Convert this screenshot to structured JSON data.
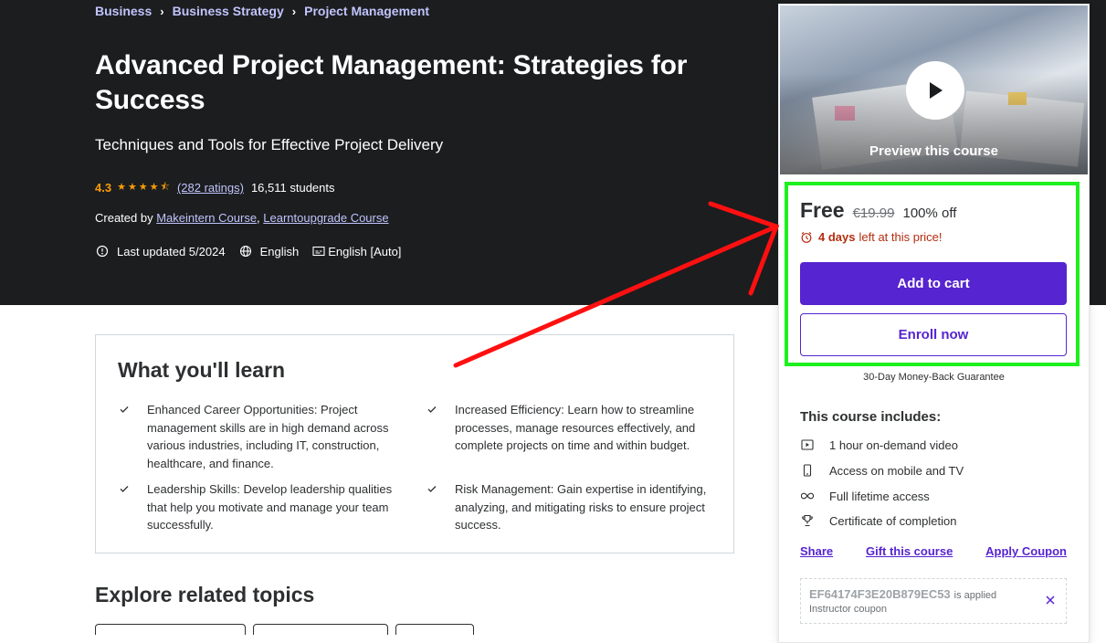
{
  "breadcrumb": [
    "Business",
    "Business Strategy",
    "Project Management"
  ],
  "course": {
    "title": "Advanced Project Management: Strategies for Success",
    "subtitle": "Techniques and Tools for Effective Project Delivery",
    "rating": "4.3",
    "ratings_count": "(282 ratings)",
    "students": "16,511 students",
    "created_by_label": "Created by",
    "instructors": [
      "Makeintern Course",
      "Learntoupgrade Course"
    ],
    "last_updated": "Last updated 5/2024",
    "language": "English",
    "captions": "English [Auto]"
  },
  "learn": {
    "title": "What you'll learn",
    "items": [
      "Enhanced Career Opportunities: Project management skills are in high demand across various industries, including IT, construction, healthcare, and finance.",
      "Increased Efficiency: Learn how to streamline processes, manage resources effectively, and complete projects on time and within budget.",
      "Leadership Skills: Develop leadership qualities that help you motivate and manage your team successfully.",
      "Risk Management: Gain expertise in identifying, analyzing, and mitigating risks to ensure project success."
    ]
  },
  "related": {
    "title": "Explore related topics"
  },
  "sidebar": {
    "preview_label": "Preview this course",
    "price": "Free",
    "original_price": "€19.99",
    "discount": "100% off",
    "timer_days": "4 days",
    "timer_text": "left at this price!",
    "add_to_cart": "Add to cart",
    "enroll_now": "Enroll now",
    "guarantee": "30-Day Money-Back Guarantee",
    "includes_title": "This course includes:",
    "includes": [
      {
        "icon": "video-icon",
        "label": "1 hour on-demand video"
      },
      {
        "icon": "mobile-icon",
        "label": "Access on mobile and TV"
      },
      {
        "icon": "infinity-icon",
        "label": "Full lifetime access"
      },
      {
        "icon": "trophy-icon",
        "label": "Certificate of completion"
      }
    ],
    "links": [
      "Share",
      "Gift this course",
      "Apply Coupon"
    ],
    "coupon_code": "EF64174F3E20B879EC53",
    "coupon_applied": "is applied",
    "coupon_type": "Instructor coupon"
  },
  "colors": {
    "hero_bg": "#1c1d1f",
    "accent_purple": "#5624d0",
    "link_lavender": "#c0c4fc",
    "star_orange": "#f69c08",
    "timer_red": "#b32d0f",
    "annotation_green": "#1ef01e",
    "annotation_red": "#ff0000"
  }
}
